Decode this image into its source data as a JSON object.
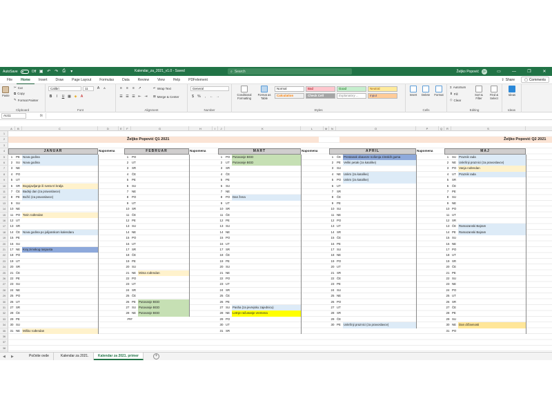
{
  "titlebar": {
    "autosave_label": "AutoSave",
    "toggle_state": "Off",
    "doc_title": "Kalendar_za_2021_v1.0 - Saved",
    "search_placeholder": "Search",
    "user_name": "Željko Popović",
    "avatar_initials": "ŽP"
  },
  "menu": {
    "tabs": [
      "File",
      "Home",
      "Insert",
      "Draw",
      "Page Layout",
      "Formulas",
      "Data",
      "Review",
      "View",
      "Help",
      "PDFelement"
    ],
    "share": "Share",
    "comments": "Comments"
  },
  "ribbon": {
    "clipboard": {
      "label": "Clipboard",
      "paste": "Paste",
      "cut": "Cut",
      "copy": "Copy",
      "format_painter": "Format Painter"
    },
    "font": {
      "label": "Font",
      "font_name": "Calibri",
      "font_size": "11"
    },
    "alignment": {
      "label": "Alignment",
      "wrap_text": "Wrap Text",
      "merge_center": "Merge & Center"
    },
    "number": {
      "label": "Number",
      "format": "General",
      "dollar": "$",
      "percent": "%",
      "comma": ","
    },
    "styles": {
      "label": "Styles",
      "conditional_formatting": "Conditional Formatting",
      "format_as_table": "Format as Table",
      "cells": [
        "Normal",
        "Bad",
        "Good",
        "Neutral",
        "Calculation",
        "Check Cell",
        "Explanatory ...",
        "Input"
      ]
    },
    "cells_group": {
      "label": "Cells",
      "insert": "Insert",
      "delete": "Delete",
      "format": "Format"
    },
    "editing": {
      "label": "Editing",
      "autosum": "AutoSum",
      "fill": "Fill",
      "clear": "Clear",
      "sort_filter": "Sort & Filter",
      "find_select": "Find & Select"
    },
    "ideas": {
      "label": "Ideas",
      "ideas_btn": "Ideas"
    }
  },
  "formula_bar": {
    "name_box": "AU11",
    "fx": "fx"
  },
  "grid": {
    "columns": [
      "A",
      "B",
      "C",
      "D",
      "E",
      "F",
      "G",
      "H",
      "I",
      "J",
      "K",
      "L",
      "M",
      "N",
      "O",
      "P",
      "Q",
      "R",
      "S"
    ],
    "q1_title": "Željko Popović Q1 2021",
    "q2_title": "Željko Popović Q2 2021",
    "note_header": "Napomena",
    "months": [
      "JANUAR",
      "FEBRUAR",
      "MART",
      "APRIL",
      "MAJ"
    ],
    "hash": "###",
    "month_days": [
      {
        "dows": [
          "PE",
          "SU",
          "NE",
          "PO",
          "UT",
          "SR",
          "ČE",
          "PE",
          "SU",
          "NE",
          "PO",
          "UT",
          "SR",
          "ČE",
          "PE",
          "SU",
          "NE",
          "PO",
          "UT",
          "SR",
          "ČE",
          "PE",
          "SU",
          "NE",
          "PO",
          "UT",
          "SR",
          "ČE",
          "PE",
          "SU",
          "NE"
        ],
        "notes": {
          "1": "Nova godina",
          "2": "Nova godina",
          "6": "Bogojavljanje ili sveta tri kralja",
          "7": "Badnji dan (za pravoslavce)",
          "8": "Božić (za pravoslavce)",
          "11": "Tarin rođendan",
          "14": "Nova godina po julijanskom kalendaru",
          "17": "Kraj zimskog raspusta",
          "31": "Miško rođendan"
        },
        "colors": {
          "1": "#ddebf7",
          "2": "#ddebf7",
          "6": "#fff2cc",
          "7": "#ddebf7",
          "8": "#ddebf7",
          "11": "#fff2cc",
          "14": "#ddebf7",
          "17": "#8ea9db",
          "31": "#fff2cc"
        }
      },
      {
        "dows": [
          "PO",
          "UT",
          "SR",
          "ČE",
          "PE",
          "SU",
          "NE",
          "PO",
          "UT",
          "SR",
          "ČE",
          "PE",
          "SU",
          "NE",
          "PO",
          "UT",
          "SR",
          "ČE",
          "PE",
          "SU",
          "NE",
          "PO",
          "UT",
          "SR",
          "ČE",
          "PE",
          "SU",
          "NE"
        ],
        "notes": {
          "21": "Mima rođendan",
          "26": "Putovanje BGD",
          "27": "Putovanje BGD",
          "28": "Putovanje BGD"
        },
        "colors": {
          "21": "#fff2cc",
          "26": "#c6e0b4",
          "27": "#c6e0b4",
          "28": "#c6e0b4"
        }
      },
      {
        "dows": [
          "PO",
          "UT",
          "SR",
          "ČE",
          "PE",
          "SU",
          "NE",
          "PO",
          "UT",
          "SR",
          "ČE",
          "PE",
          "SU",
          "NE",
          "PO",
          "UT",
          "SR",
          "ČE",
          "PE",
          "SU",
          "NE",
          "PO",
          "UT",
          "SR",
          "ČE",
          "PE",
          "SU",
          "NE",
          "PO",
          "UT",
          "SR"
        ],
        "notes": {
          "1": "Putovanje BGD",
          "2": "Putovanje BGD",
          "8": "Dan žena",
          "27": "Pasha (za jevrejsku zajednicu)",
          "28": "Letnje računanje vremena"
        },
        "colors": {
          "1": "#c6e0b4",
          "2": "#c6e0b4",
          "8": "#ddebf7",
          "27": "#ddebf7",
          "28": "#ffff00"
        }
      },
      {
        "dows": [
          "ČE",
          "PE",
          "SU",
          "NE",
          "PO",
          "UT",
          "SR",
          "ČE",
          "PE",
          "SU",
          "NE",
          "PO",
          "UT",
          "SR",
          "ČE",
          "PE",
          "SU",
          "NE",
          "PO",
          "UT",
          "SR",
          "ČE",
          "PE",
          "SU",
          "NE",
          "PO",
          "UT",
          "SR",
          "ČE",
          "PE"
        ],
        "notes": {
          "1": "Prestanak obaveze nošenja zimskih guma",
          "2": "Veliki petak (za katolike)",
          "4": "Uskrs (za katolike)",
          "5": "Uskrs (za katolike)",
          "30": "Uskršnji praznici (za pravoslavce)"
        },
        "colors": {
          "1": "#8ea9db",
          "2": "#ddebf7",
          "4": "#ddebf7",
          "5": "#ddebf7",
          "30": "#ddebf7"
        }
      },
      {
        "dows": [
          "SU",
          "NE",
          "PO",
          "UT",
          "SR",
          "ČE",
          "PE",
          "SU",
          "NE",
          "PO",
          "UT",
          "SR",
          "ČE",
          "PE",
          "SU",
          "NE",
          "PO",
          "UT",
          "SR",
          "ČE",
          "PE",
          "SU",
          "NE",
          "PO",
          "UT",
          "SR",
          "ČE",
          "PE",
          "SU",
          "NE",
          "PO"
        ],
        "notes": {
          "1": "Praznik rada",
          "2": "Uskršnji praznici (za pravoslavce)",
          "3": "Vanja rođendan",
          "4": "Praznik rada",
          "13": "Ramazanski Bajram",
          "14": "Ramazanski Bajram",
          "30": "Dan državnosti"
        },
        "colors": {
          "1": "#ddebf7",
          "2": "#ddebf7",
          "3": "#fff2cc",
          "4": "#ddebf7",
          "13": "#ddebf7",
          "14": "#ddebf7",
          "30": "#ffe699"
        }
      }
    ]
  },
  "sheets": {
    "nav_prev": "◀",
    "nav_next": "▶",
    "tabs": [
      "Počnite ovde",
      "Kalendar za 2021.",
      "Kalendar za 2021. primer"
    ],
    "active_index": 2,
    "add": "+"
  }
}
